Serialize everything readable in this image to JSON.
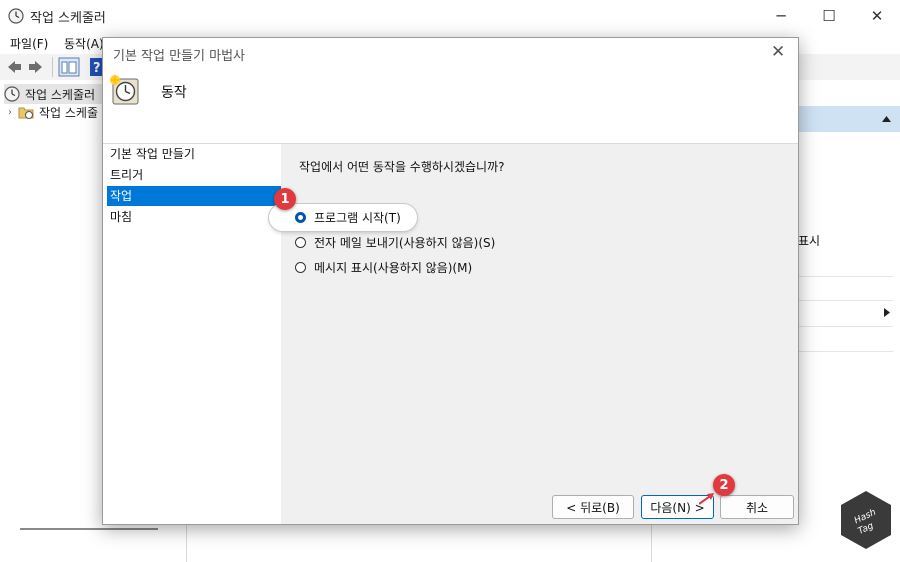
{
  "main_window": {
    "title": "작업 스케줄러",
    "controls": {
      "minimize": "─",
      "maximize": "☐",
      "close": "✕"
    },
    "menu": [
      "파일(F)",
      "동작(A)"
    ],
    "tree": [
      {
        "label": "작업 스케줄러",
        "selected": true
      },
      {
        "label": "작업 스케줄",
        "selected": false
      }
    ],
    "right_pane": {
      "text_display": "표시"
    }
  },
  "dialog": {
    "title": "기본 작업 만들기 마법사",
    "close_glyph": "✕",
    "header_title": "동작",
    "steps": [
      {
        "label": "기본 작업 만들기",
        "active": false
      },
      {
        "label": "트리거",
        "active": false
      },
      {
        "label": "작업",
        "active": true
      },
      {
        "label": "마침",
        "active": false
      }
    ],
    "question": "작업에서 어떤 동작을 수행하시겠습니까?",
    "options": [
      {
        "label": "프로그램 시작(T)",
        "checked": true
      },
      {
        "label": "전자 메일 보내기(사용하지 않음)(S)",
        "checked": false
      },
      {
        "label": "메시지 표시(사용하지 않음)(M)",
        "checked": false
      }
    ],
    "buttons": {
      "back": "< 뒤로(B)",
      "next": "다음(N) >",
      "cancel": "취소"
    }
  },
  "annotations": {
    "badge1": "1",
    "badge2": "2"
  },
  "watermark": {
    "line1": "Hash",
    "line2": "Tag"
  },
  "colors": {
    "accent": "#0078d7",
    "badge": "#e0393e",
    "actions_header": "#cfe2f3"
  }
}
